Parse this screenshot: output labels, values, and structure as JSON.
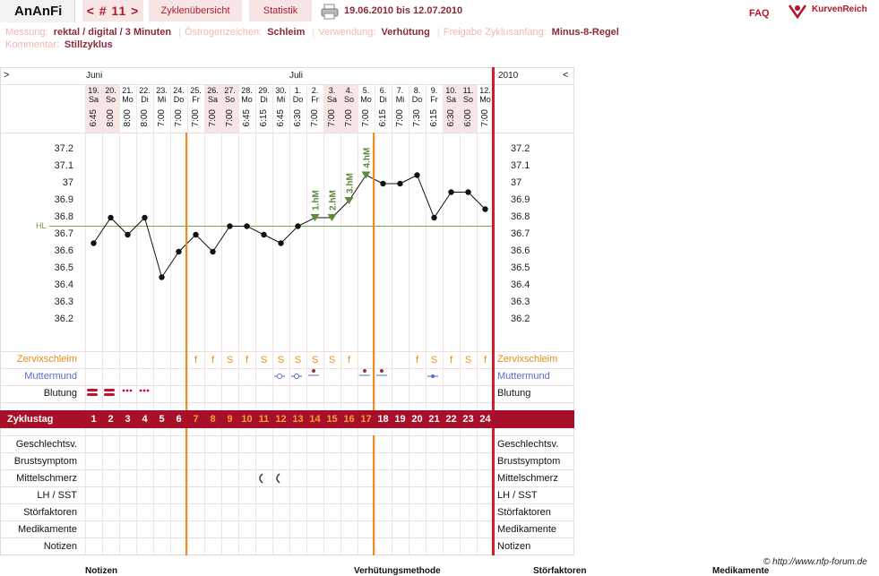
{
  "app": {
    "title": "AnAnFi"
  },
  "nav": {
    "cycle": "< # 11 >",
    "overview": "Zyklenübersicht",
    "stats": "Statistik",
    "date_range": "19.06.2010 bis 12.07.2010",
    "faq": "FAQ",
    "logo": "KurvenReich"
  },
  "meta": {
    "messung_label": "Messung:",
    "messung": "rektal / digital / 3 Minuten",
    "oestro_label": "Östrogenzeichen:",
    "oestro": "Schleim",
    "verw_label": "Verwendung:",
    "verw": "Verhütung",
    "freigabe_label": "Freigabe Zyklusanfang:",
    "freigabe": "Minus-8-Regel",
    "kommentar_label": "Kommentar:",
    "kommentar": "Stillzyklus"
  },
  "chart": {
    "nav_left": ">",
    "nav_right": "<",
    "year": "2010",
    "month1": "Juni",
    "month2": "Juli",
    "hl_label": "HL",
    "accent": "#a8102a"
  },
  "chart_data": {
    "type": "line",
    "title": "",
    "xlabel": "",
    "ylabel": "",
    "ylim": [
      36.1,
      37.3
    ],
    "y_ticks": [
      "37.2",
      "37.1",
      "37",
      "36.9",
      "36.8",
      "36.7",
      "36.6",
      "36.5",
      "36.4",
      "36.3",
      "36.2"
    ],
    "hilfslinie": 36.75,
    "days": [
      {
        "date": "19.",
        "wd": "Sa",
        "time": "6:45",
        "temp": 36.65
      },
      {
        "date": "20.",
        "wd": "So",
        "time": "8:00",
        "temp": 36.8
      },
      {
        "date": "21.",
        "wd": "Mo",
        "time": "8:00",
        "temp": 36.7
      },
      {
        "date": "22.",
        "wd": "Di",
        "time": "8:00",
        "temp": 36.8
      },
      {
        "date": "23.",
        "wd": "Mi",
        "time": "7:00",
        "temp": 36.45
      },
      {
        "date": "24.",
        "wd": "Do",
        "time": "7:00",
        "temp": 36.6
      },
      {
        "date": "25.",
        "wd": "Fr",
        "time": "7:00",
        "temp": 36.7
      },
      {
        "date": "26.",
        "wd": "Sa",
        "time": "7:00",
        "temp": 36.6
      },
      {
        "date": "27.",
        "wd": "So",
        "time": "7:00",
        "temp": 36.75
      },
      {
        "date": "28.",
        "wd": "Mo",
        "time": "6:45",
        "temp": 36.75
      },
      {
        "date": "29.",
        "wd": "Di",
        "time": "6:15",
        "temp": 36.7
      },
      {
        "date": "30.",
        "wd": "Mi",
        "time": "6:45",
        "temp": 36.65
      },
      {
        "date": "1.",
        "wd": "Do",
        "time": "6:30",
        "temp": 36.75
      },
      {
        "date": "2.",
        "wd": "Fr",
        "time": "7:00",
        "temp": 36.8
      },
      {
        "date": "3.",
        "wd": "Sa",
        "time": "7:00",
        "temp": 36.8
      },
      {
        "date": "4.",
        "wd": "So",
        "time": "7:00",
        "temp": 36.9
      },
      {
        "date": "5.",
        "wd": "Mo",
        "time": "7:00",
        "temp": 37.05
      },
      {
        "date": "6.",
        "wd": "Di",
        "time": "6:15",
        "temp": 37.0
      },
      {
        "date": "7.",
        "wd": "Mi",
        "time": "7:00",
        "temp": 37.0
      },
      {
        "date": "8.",
        "wd": "Do",
        "time": "7:30",
        "temp": 37.05
      },
      {
        "date": "9.",
        "wd": "Fr",
        "time": "6:15",
        "temp": 36.8
      },
      {
        "date": "10.",
        "wd": "Sa",
        "time": "6:30",
        "temp": 36.95
      },
      {
        "date": "11.",
        "wd": "So",
        "time": "6:00",
        "temp": 36.95
      },
      {
        "date": "12.",
        "wd": "Mo",
        "time": "7:00",
        "temp": 36.85
      }
    ],
    "hm_labels": [
      {
        "day": 14,
        "text": "1.hM"
      },
      {
        "day": 15,
        "text": "2.hM"
      },
      {
        "day": 16,
        "text": "3.hM"
      },
      {
        "day": 17,
        "text": "4.hM"
      }
    ],
    "cycle_days": [
      "1",
      "2",
      "3",
      "4",
      "5",
      "6",
      "7",
      "8",
      "9",
      "10",
      "11",
      "12",
      "13",
      "14",
      "15",
      "16",
      "17",
      "18",
      "19",
      "20",
      "21",
      "22",
      "23",
      "24"
    ],
    "zervix": [
      "",
      "",
      "",
      "",
      "",
      "",
      "f",
      "f",
      "S",
      "f",
      "S",
      "S",
      "S",
      "S",
      "S",
      "f",
      "",
      "",
      "",
      "f",
      "S",
      "f",
      "S",
      "f"
    ]
  },
  "rows": {
    "zervix": "Zervixschleim",
    "muttermund": "Muttermund",
    "blutung": "Blutung",
    "zyklustag": "Zyklustag",
    "gv": "Geschlechtsv.",
    "brust": "Brustsymptom",
    "mittel": "Mittelschmerz",
    "lh": "LH / SST",
    "stoer": "Störfaktoren",
    "medi": "Medikamente",
    "notizen": "Notizen"
  },
  "footer": {
    "copyright": "© http://www.nfp-forum.de",
    "col_notizen": "Notizen",
    "col_verh": "Verhütungsmethode",
    "col_stoer": "Störfaktoren",
    "col_medi": "Medikamente"
  }
}
